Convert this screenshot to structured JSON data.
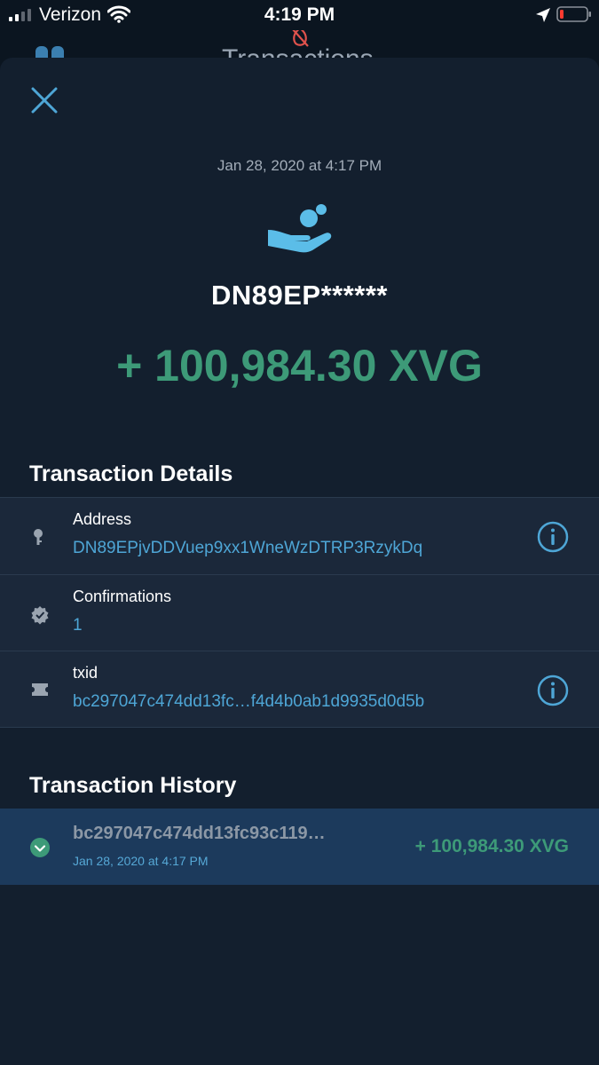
{
  "status_bar": {
    "carrier": "Verizon",
    "time": "4:19 PM"
  },
  "background_screen": {
    "title": "Transactions"
  },
  "transaction": {
    "date": "Jan 28, 2020 at 4:17 PM",
    "title": "DN89EP******",
    "amount": "+ 100,984.30 XVG"
  },
  "details": {
    "heading": "Transaction Details",
    "rows": [
      {
        "label": "Address",
        "value": "DN89EPjvDDVuep9xx1WneWzDTRP3RzykDq",
        "icon": "key-icon"
      },
      {
        "label": "Confirmations",
        "value": "1",
        "icon": "verified-badge-icon"
      },
      {
        "label": "txid",
        "value": "bc297047c474dd13fc…f4d4b0ab1d9935d0d5b",
        "icon": "ticket-icon"
      }
    ]
  },
  "history": {
    "heading": "Transaction History",
    "items": [
      {
        "txid": "bc297047c474dd13fc93c119…",
        "date": "Jan 28, 2020 at 4:17 PM",
        "amount": "+ 100,984.30 XVG"
      }
    ]
  },
  "colors": {
    "accent_blue": "#4ea6d6",
    "positive_green": "#3d9a78",
    "sheet_bg": "#131f2e",
    "row_bg": "#1b283a",
    "history_highlight": "#1c3a5c"
  }
}
